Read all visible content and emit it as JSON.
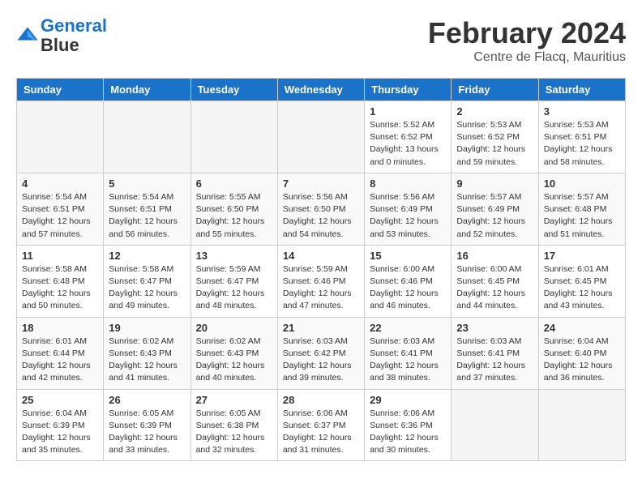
{
  "header": {
    "logo_line1": "General",
    "logo_line2": "Blue",
    "month_year": "February 2024",
    "location": "Centre de Flacq, Mauritius"
  },
  "weekdays": [
    "Sunday",
    "Monday",
    "Tuesday",
    "Wednesday",
    "Thursday",
    "Friday",
    "Saturday"
  ],
  "weeks": [
    [
      {
        "day": "",
        "info": ""
      },
      {
        "day": "",
        "info": ""
      },
      {
        "day": "",
        "info": ""
      },
      {
        "day": "",
        "info": ""
      },
      {
        "day": "1",
        "info": "Sunrise: 5:52 AM\nSunset: 6:52 PM\nDaylight: 13 hours\nand 0 minutes."
      },
      {
        "day": "2",
        "info": "Sunrise: 5:53 AM\nSunset: 6:52 PM\nDaylight: 12 hours\nand 59 minutes."
      },
      {
        "day": "3",
        "info": "Sunrise: 5:53 AM\nSunset: 6:51 PM\nDaylight: 12 hours\nand 58 minutes."
      }
    ],
    [
      {
        "day": "4",
        "info": "Sunrise: 5:54 AM\nSunset: 6:51 PM\nDaylight: 12 hours\nand 57 minutes."
      },
      {
        "day": "5",
        "info": "Sunrise: 5:54 AM\nSunset: 6:51 PM\nDaylight: 12 hours\nand 56 minutes."
      },
      {
        "day": "6",
        "info": "Sunrise: 5:55 AM\nSunset: 6:50 PM\nDaylight: 12 hours\nand 55 minutes."
      },
      {
        "day": "7",
        "info": "Sunrise: 5:56 AM\nSunset: 6:50 PM\nDaylight: 12 hours\nand 54 minutes."
      },
      {
        "day": "8",
        "info": "Sunrise: 5:56 AM\nSunset: 6:49 PM\nDaylight: 12 hours\nand 53 minutes."
      },
      {
        "day": "9",
        "info": "Sunrise: 5:57 AM\nSunset: 6:49 PM\nDaylight: 12 hours\nand 52 minutes."
      },
      {
        "day": "10",
        "info": "Sunrise: 5:57 AM\nSunset: 6:48 PM\nDaylight: 12 hours\nand 51 minutes."
      }
    ],
    [
      {
        "day": "11",
        "info": "Sunrise: 5:58 AM\nSunset: 6:48 PM\nDaylight: 12 hours\nand 50 minutes."
      },
      {
        "day": "12",
        "info": "Sunrise: 5:58 AM\nSunset: 6:47 PM\nDaylight: 12 hours\nand 49 minutes."
      },
      {
        "day": "13",
        "info": "Sunrise: 5:59 AM\nSunset: 6:47 PM\nDaylight: 12 hours\nand 48 minutes."
      },
      {
        "day": "14",
        "info": "Sunrise: 5:59 AM\nSunset: 6:46 PM\nDaylight: 12 hours\nand 47 minutes."
      },
      {
        "day": "15",
        "info": "Sunrise: 6:00 AM\nSunset: 6:46 PM\nDaylight: 12 hours\nand 46 minutes."
      },
      {
        "day": "16",
        "info": "Sunrise: 6:00 AM\nSunset: 6:45 PM\nDaylight: 12 hours\nand 44 minutes."
      },
      {
        "day": "17",
        "info": "Sunrise: 6:01 AM\nSunset: 6:45 PM\nDaylight: 12 hours\nand 43 minutes."
      }
    ],
    [
      {
        "day": "18",
        "info": "Sunrise: 6:01 AM\nSunset: 6:44 PM\nDaylight: 12 hours\nand 42 minutes."
      },
      {
        "day": "19",
        "info": "Sunrise: 6:02 AM\nSunset: 6:43 PM\nDaylight: 12 hours\nand 41 minutes."
      },
      {
        "day": "20",
        "info": "Sunrise: 6:02 AM\nSunset: 6:43 PM\nDaylight: 12 hours\nand 40 minutes."
      },
      {
        "day": "21",
        "info": "Sunrise: 6:03 AM\nSunset: 6:42 PM\nDaylight: 12 hours\nand 39 minutes."
      },
      {
        "day": "22",
        "info": "Sunrise: 6:03 AM\nSunset: 6:41 PM\nDaylight: 12 hours\nand 38 minutes."
      },
      {
        "day": "23",
        "info": "Sunrise: 6:03 AM\nSunset: 6:41 PM\nDaylight: 12 hours\nand 37 minutes."
      },
      {
        "day": "24",
        "info": "Sunrise: 6:04 AM\nSunset: 6:40 PM\nDaylight: 12 hours\nand 36 minutes."
      }
    ],
    [
      {
        "day": "25",
        "info": "Sunrise: 6:04 AM\nSunset: 6:39 PM\nDaylight: 12 hours\nand 35 minutes."
      },
      {
        "day": "26",
        "info": "Sunrise: 6:05 AM\nSunset: 6:39 PM\nDaylight: 12 hours\nand 33 minutes."
      },
      {
        "day": "27",
        "info": "Sunrise: 6:05 AM\nSunset: 6:38 PM\nDaylight: 12 hours\nand 32 minutes."
      },
      {
        "day": "28",
        "info": "Sunrise: 6:06 AM\nSunset: 6:37 PM\nDaylight: 12 hours\nand 31 minutes."
      },
      {
        "day": "29",
        "info": "Sunrise: 6:06 AM\nSunset: 6:36 PM\nDaylight: 12 hours\nand 30 minutes."
      },
      {
        "day": "",
        "info": ""
      },
      {
        "day": "",
        "info": ""
      }
    ]
  ]
}
